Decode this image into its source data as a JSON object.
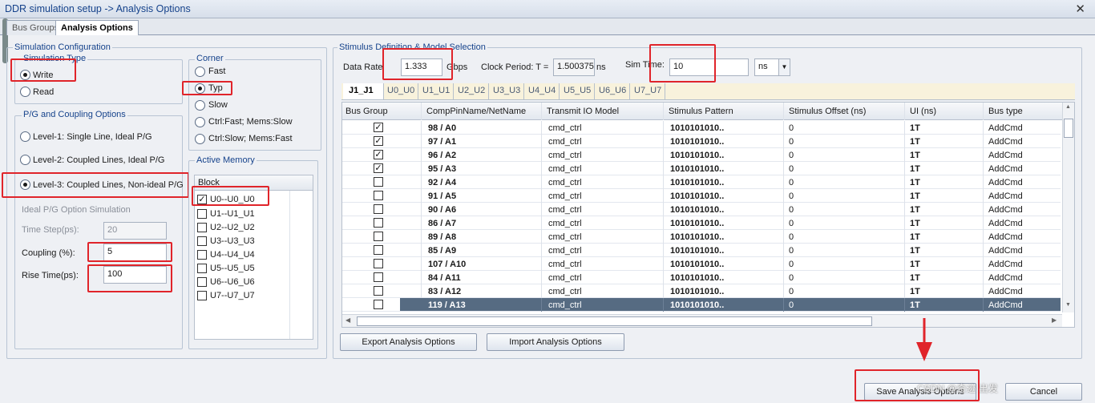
{
  "window": {
    "title": "DDR simulation setup -> Analysis Options",
    "close_glyph": "✕"
  },
  "tabs": [
    {
      "label": "Bus Groups"
    },
    {
      "label": "Analysis Options"
    }
  ],
  "sim_config": {
    "legend": "Simulation Configuration",
    "sim_type": {
      "legend": "Simulation Type",
      "options": [
        "Write",
        "Read"
      ],
      "selected": "Write"
    },
    "pg": {
      "legend": "P/G and Coupling Options",
      "options": [
        "Level-1: Single Line, Ideal P/G",
        "Level-2: Coupled Lines, Ideal P/G",
        "Level-3: Coupled Lines, Non-ideal P/G"
      ],
      "selected": "Level-3: Coupled Lines, Non-ideal P/G",
      "ideal_sim_label": "Ideal P/G Option Simulation",
      "time_step_label": "Time Step(ps):",
      "time_step_value": "20",
      "coupling_label": "Coupling (%):",
      "coupling_value": "5",
      "rise_time_label": "Rise Time(ps):",
      "rise_time_value": "100"
    },
    "corner": {
      "legend": "Corner",
      "options": [
        "Fast",
        "Typ",
        "Slow",
        "Ctrl:Fast; Mems:Slow",
        "Ctrl:Slow; Mems:Fast"
      ],
      "selected": "Typ"
    },
    "active_memory": {
      "legend": "Active Memory",
      "column": "Block",
      "items": [
        {
          "label": "U0--U0_U0",
          "checked": true
        },
        {
          "label": "U1--U1_U1",
          "checked": false
        },
        {
          "label": "U2--U2_U2",
          "checked": false
        },
        {
          "label": "U3--U3_U3",
          "checked": false
        },
        {
          "label": "U4--U4_U4",
          "checked": false
        },
        {
          "label": "U5--U5_U5",
          "checked": false
        },
        {
          "label": "U6--U6_U6",
          "checked": false
        },
        {
          "label": "U7--U7_U7",
          "checked": false
        }
      ]
    }
  },
  "stimulus": {
    "legend": "Stimulus Definition & Model Selection",
    "data_rate_label": "Data Rate",
    "data_rate_value": "1.333",
    "data_rate_unit": "Gbps",
    "clock_period_label": "Clock Period: T =",
    "clock_period_value": "1.500375",
    "clock_period_unit": "ns",
    "sim_time_label": "Sim Time:",
    "sim_time_value": "10",
    "sim_time_unit": "ns",
    "subtabs": [
      "J1_J1",
      "U0_U0",
      "U1_U1",
      "U2_U2",
      "U3_U3",
      "U4_U4",
      "U5_U5",
      "U6_U6",
      "U7_U7"
    ],
    "columns": [
      "Bus Group",
      "CompPinName/NetName",
      "Transmit IO Model",
      "Stimulus Pattern",
      "Stimulus Offset (ns)",
      "UI (ns)",
      "Bus type"
    ],
    "rows": [
      {
        "checked": true,
        "net": "98 / A0",
        "model": "cmd_ctrl",
        "pattern": "1010101010..",
        "offset": "0",
        "ui": "1T",
        "bus": "AddCmd"
      },
      {
        "checked": true,
        "net": "97 / A1",
        "model": "cmd_ctrl",
        "pattern": "1010101010..",
        "offset": "0",
        "ui": "1T",
        "bus": "AddCmd"
      },
      {
        "checked": true,
        "net": "96 / A2",
        "model": "cmd_ctrl",
        "pattern": "1010101010..",
        "offset": "0",
        "ui": "1T",
        "bus": "AddCmd"
      },
      {
        "checked": true,
        "net": "95 / A3",
        "model": "cmd_ctrl",
        "pattern": "1010101010..",
        "offset": "0",
        "ui": "1T",
        "bus": "AddCmd"
      },
      {
        "checked": false,
        "net": "92 / A4",
        "model": "cmd_ctrl",
        "pattern": "1010101010..",
        "offset": "0",
        "ui": "1T",
        "bus": "AddCmd"
      },
      {
        "checked": false,
        "net": "91 / A5",
        "model": "cmd_ctrl",
        "pattern": "1010101010..",
        "offset": "0",
        "ui": "1T",
        "bus": "AddCmd"
      },
      {
        "checked": false,
        "net": "90 / A6",
        "model": "cmd_ctrl",
        "pattern": "1010101010..",
        "offset": "0",
        "ui": "1T",
        "bus": "AddCmd"
      },
      {
        "checked": false,
        "net": "86 / A7",
        "model": "cmd_ctrl",
        "pattern": "1010101010..",
        "offset": "0",
        "ui": "1T",
        "bus": "AddCmd"
      },
      {
        "checked": false,
        "net": "89 / A8",
        "model": "cmd_ctrl",
        "pattern": "1010101010..",
        "offset": "0",
        "ui": "1T",
        "bus": "AddCmd"
      },
      {
        "checked": false,
        "net": "85 / A9",
        "model": "cmd_ctrl",
        "pattern": "1010101010..",
        "offset": "0",
        "ui": "1T",
        "bus": "AddCmd"
      },
      {
        "checked": false,
        "net": "107 / A10",
        "model": "cmd_ctrl",
        "pattern": "1010101010..",
        "offset": "0",
        "ui": "1T",
        "bus": "AddCmd"
      },
      {
        "checked": false,
        "net": "84 / A11",
        "model": "cmd_ctrl",
        "pattern": "1010101010..",
        "offset": "0",
        "ui": "1T",
        "bus": "AddCmd"
      },
      {
        "checked": false,
        "net": "83 / A12",
        "model": "cmd_ctrl",
        "pattern": "1010101010..",
        "offset": "0",
        "ui": "1T",
        "bus": "AddCmd"
      },
      {
        "checked": false,
        "net": "119 / A13",
        "model": "cmd_ctrl",
        "pattern": "1010101010..",
        "offset": "0",
        "ui": "1T",
        "bus": "AddCmd",
        "selected": true
      }
    ],
    "export_label": "Export Analysis Options",
    "import_label": "Import Analysis Options"
  },
  "footer": {
    "save_label": "Save Analysis Options",
    "cancel_label": "Cancel",
    "watermark": "CSDN @奇迹 出发"
  },
  "colors": {
    "annotation_red": "#e0242a",
    "selected_row": "#566b82",
    "title_text": "#15428b"
  }
}
